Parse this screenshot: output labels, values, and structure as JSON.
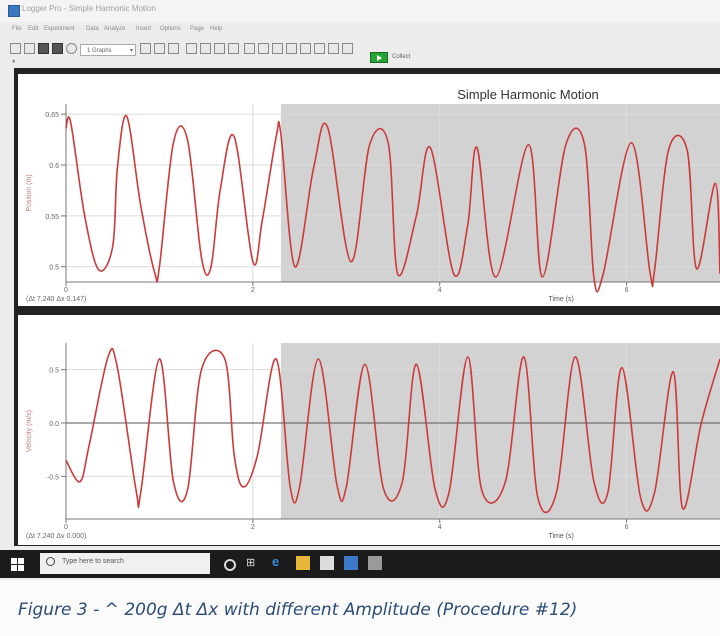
{
  "window": {
    "title": "Logger Pro - Simple Harmonic Motion"
  },
  "menu": [
    "File",
    "Edit",
    "Experiment",
    "Data",
    "Analyze",
    "Insert",
    "Options",
    "Page",
    "Help"
  ],
  "toolbar": {
    "page_select": "1 Graphs",
    "collect_label": "Collect"
  },
  "page_marker": "*",
  "taskbar": {
    "search_placeholder": "Type here to search"
  },
  "caption": "Figure 3 - ^ 200g Δt Δx with different Amplitude (Procedure #12)",
  "colors": {
    "trace": "#cc3a3a",
    "selection": "#d2d2d2",
    "grid": "#dcdcdc",
    "caption": "#2b4c78"
  },
  "chart_data": [
    {
      "type": "line",
      "title": "Simple Harmonic Motion",
      "xlabel": "Time (s)",
      "ylabel": "Position (m)",
      "xlim": [
        0,
        7
      ],
      "ylim": [
        0.485,
        0.66
      ],
      "yticks": [
        0.5,
        0.55,
        0.6,
        0.65
      ],
      "xticks": [
        0,
        2,
        4,
        6
      ],
      "readout": "(Δt 7.240  Δx 0.147)",
      "selection": [
        2.3,
        7
      ],
      "series": [
        {
          "x": [
            0.0,
            0.05,
            0.2,
            0.35,
            0.5,
            0.55,
            0.65,
            0.8,
            0.95,
            1.0,
            1.15,
            1.3,
            1.45,
            1.55,
            1.65,
            1.8,
            2.0,
            2.1,
            2.25,
            2.3,
            2.45,
            2.65,
            2.8,
            3.05,
            3.25,
            3.45,
            3.55,
            3.75,
            3.9,
            4.15,
            4.3,
            4.4,
            4.6,
            4.95,
            5.1,
            5.35,
            5.55,
            5.65,
            5.75,
            6.05,
            6.25,
            6.3,
            6.45,
            6.65,
            6.75,
            6.95,
            7.0
          ],
          "y": [
            0.636,
            0.642,
            0.55,
            0.497,
            0.52,
            0.597,
            0.648,
            0.56,
            0.494,
            0.5,
            0.622,
            0.625,
            0.509,
            0.499,
            0.575,
            0.628,
            0.505,
            0.545,
            0.628,
            0.63,
            0.5,
            0.597,
            0.637,
            0.505,
            0.62,
            0.621,
            0.493,
            0.55,
            0.617,
            0.493,
            0.541,
            0.617,
            0.49,
            0.62,
            0.49,
            0.62,
            0.62,
            0.49,
            0.493,
            0.622,
            0.495,
            0.497,
            0.615,
            0.614,
            0.498,
            0.582,
            0.493
          ]
        }
      ]
    },
    {
      "type": "line",
      "xlabel": "Time (s)",
      "ylabel": "Velocity (m/s)",
      "xlim": [
        0,
        7
      ],
      "ylim": [
        -0.9,
        0.75
      ],
      "yticks": [
        -0.5,
        0.0,
        0.5
      ],
      "xticks": [
        0,
        2,
        4,
        6
      ],
      "readout": "(Δt 7.240  Δv 0.000)",
      "selection": [
        2.3,
        7
      ],
      "series": [
        {
          "x": [
            0.0,
            0.15,
            0.25,
            0.45,
            0.55,
            0.75,
            0.8,
            1.0,
            1.15,
            1.3,
            1.45,
            1.7,
            1.8,
            1.9,
            2.05,
            2.25,
            2.4,
            2.5,
            2.7,
            2.9,
            3.0,
            3.2,
            3.4,
            3.6,
            3.75,
            3.95,
            4.1,
            4.3,
            4.45,
            4.7,
            4.9,
            5.05,
            5.25,
            5.45,
            5.65,
            5.8,
            5.95,
            6.15,
            6.3,
            6.5,
            6.6,
            6.8,
            7.0
          ],
          "y": [
            -0.35,
            -0.55,
            -0.2,
            0.62,
            0.52,
            -0.63,
            -0.65,
            0.6,
            -0.55,
            -0.63,
            0.5,
            0.6,
            -0.3,
            -0.6,
            -0.3,
            0.6,
            -0.6,
            -0.6,
            0.6,
            -0.58,
            -0.6,
            0.55,
            -0.62,
            -0.55,
            0.55,
            -0.62,
            -0.65,
            0.62,
            -0.63,
            -0.56,
            0.62,
            -0.7,
            -0.65,
            0.62,
            -0.55,
            -0.65,
            0.52,
            -0.7,
            -0.65,
            0.48,
            -0.8,
            0.0,
            0.6
          ]
        }
      ]
    }
  ]
}
